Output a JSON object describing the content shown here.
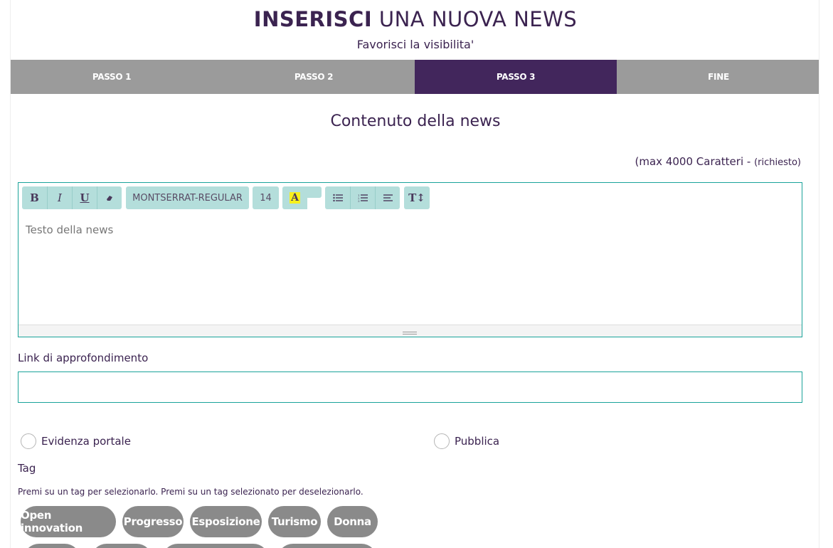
{
  "header": {
    "title_bold": "INSERISCI",
    "title_rest": " UNA NUOVA NEWS",
    "subtitle": "Favorisci la visibilita'"
  },
  "steps": [
    {
      "label": "PASSO 1",
      "active": false
    },
    {
      "label": "PASSO 2",
      "active": false
    },
    {
      "label": "PASSO 3",
      "active": true
    },
    {
      "label": "FINE",
      "active": false
    }
  ],
  "colors": {
    "accent": "#42265c",
    "step_inactive": "#9b9b9b",
    "border_teal": "#1aa39a",
    "toolbar_bg": "#b4dedb",
    "tag_bg": "#8a8a8a"
  },
  "content": {
    "section_title": "Contenuto della news",
    "max_chars": "(max 4000 Caratteri - ",
    "required": "(richiesto)",
    "required_close": ""
  },
  "editor": {
    "toolbar": {
      "bold": "B",
      "italic": "I",
      "underline": "U",
      "eraser": "eraser-icon",
      "font_name": "MONTSERRAT-REGULAR",
      "font_size": "14",
      "highlight": "A",
      "unordered_list": "unordered-list-icon",
      "ordered_list": "ordered-list-icon",
      "align": "align-icon",
      "text_height": "T↕"
    },
    "placeholder": "Testo della news"
  },
  "link": {
    "label": "Link di approfondimento",
    "value": ""
  },
  "options": {
    "evidenza": "Evidenza portale",
    "pubblica": "Pubblica"
  },
  "tags": {
    "label": "Tag",
    "help": "Premi su un tag per selezionarlo. Premi su un tag selezionato per deselezionarlo.",
    "items": [
      "Open innovation",
      "Progresso",
      "Esposizione",
      "Turismo",
      "Donna"
    ]
  }
}
